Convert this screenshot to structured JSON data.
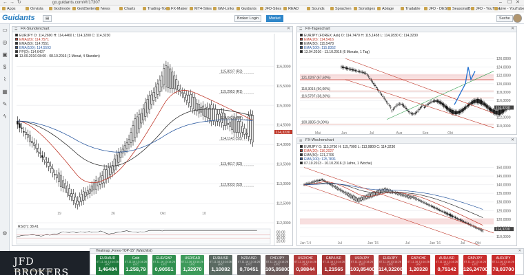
{
  "browser": {
    "url": "go.guidants.com/#!/17307",
    "window_controls": [
      "–",
      "☐",
      "✕"
    ]
  },
  "bookmarks": [
    "Apps",
    "Onvista",
    "Godmode",
    "GoldSeiten",
    "News",
    "Charts",
    "Trading-Tools",
    "FX-Maker",
    "MT4-Sites",
    "GM-Links",
    "Guidants",
    "JFD-Sites",
    "READ",
    "Sounds",
    "Sprachen",
    "Sonstiges",
    "Ablage",
    "Tradable",
    "JFD - DESK",
    "SeasonalBull",
    "JFD - YouTube",
    "Live - YouTube"
  ],
  "header": {
    "logo": "Guidants",
    "broker_login": "Broker Login",
    "market": "Market",
    "search": "Suche"
  },
  "left_toolbar_icons": [
    "monitor-icon",
    "globe-icon",
    "briefcase-icon",
    "dollar-icon",
    "chart-icon",
    "gift-icon",
    "pen-icon",
    "bolt-icon",
    "gear-icon"
  ],
  "panels": {
    "stunden": {
      "title": "FX-Stundenchart",
      "legend": [
        {
          "text": "EURJPY   O: 114,2690  H: 114,4460  L: 114,1200  C: 114,3230",
          "color": "#222222"
        },
        {
          "text": "EMA(20): 114,7571",
          "color": "#c0392b"
        },
        {
          "text": "EMA(50): 114,7551",
          "color": "#333333"
        },
        {
          "text": "EMA(100): 114,5593",
          "color": "#2c5aa0"
        },
        {
          "text": "PP(D): 114,6427",
          "color": "#333333"
        },
        {
          "text": "13.09.2016 08:00 - 08.10.2016 (1 Monat, 4 Stunden)",
          "color": "#222222"
        }
      ],
      "levels": [
        {
          "label": "115,8237 (R2)"
        },
        {
          "label": "115,2953 (R1)"
        },
        {
          "label": "114,6427 (PP)"
        },
        {
          "label": "114,1143 (S1)"
        },
        {
          "label": "113,4617 (S2)"
        },
        {
          "label": "112,9333 (S3)"
        }
      ],
      "y_ticks": [
        "116,0000",
        "115,5000",
        "115,0000",
        "114,5000",
        "114,0000",
        "113,5000",
        "113,0000",
        "112,5000",
        "112,0000"
      ],
      "x_ticks": [
        "19",
        "26",
        "Okt",
        "10"
      ],
      "last_price": "114,3230",
      "rsi_label": "RSI(7): 38,41",
      "rsi_ticks": [
        "80,00",
        "60,00",
        "40,00",
        "20,00"
      ]
    },
    "tages": {
      "title": "FX-Tageschart",
      "legend": [
        {
          "text": "EURJPY (FOREX: Ask)  O: 114,7470  H: 115,1458  L: 114,2830  C: 114,3230",
          "color": "#222222"
        },
        {
          "text": "EMA(20): 114,5416",
          "color": "#c0392b"
        },
        {
          "text": "EMA(50): 115,5478",
          "color": "#333333"
        },
        {
          "text": "EMA(100): 115,8352",
          "color": "#2c5aa0"
        },
        {
          "text": "13.04.2016 - 13.10.2016 (6 Monate, 1 Tag)",
          "color": "#222222"
        }
      ],
      "fib_labels": [
        "121,0247 (67,60%)",
        "118,3015 (50,00%)",
        "116,5797 (38,20%)",
        "100,3835 (0,00%)"
      ],
      "y_ticks": [
        "126,0000",
        "124,0000",
        "122,0000",
        "120,0000",
        "118,0000",
        "116,0000",
        "114,0000",
        "112,0000",
        "110,0000"
      ],
      "x_ticks": [
        "Mai",
        "Jun",
        "Jul",
        "Aug",
        "Sep",
        "Okt"
      ],
      "last_price": "114,3230"
    },
    "wochen": {
      "title": "FX-Wochenchart",
      "legend": [
        {
          "text": "EURJPY  O: 115,3750  H: 115,7900  L: 113,9800  C: 114,3230",
          "color": "#222222"
        },
        {
          "text": "EMA(20): 116,2027",
          "color": "#c0392b"
        },
        {
          "text": "EMA(50): 121,2706",
          "color": "#333333"
        },
        {
          "text": "EMA(100): 125,7831",
          "color": "#2c5aa0"
        },
        {
          "text": "07.10.2013 - 10.10.2016 (3 Jahre, 1 Woche)",
          "color": "#222222"
        }
      ],
      "y_ticks": [
        "150,0000",
        "145,0000",
        "140,0000",
        "135,0000",
        "130,0000",
        "125,0000",
        "120,0000",
        "115,0000",
        "110,0000"
      ],
      "x_ticks": [
        "Jan '14",
        "Jul",
        "Jan '15",
        "Jul",
        "Jan '16",
        "Jul",
        "Okt"
      ],
      "last_price": "114,3230"
    }
  },
  "heatmap": {
    "title": "Heatmap „Forex-TOP-15\" (Watchlist)",
    "tiles": [
      {
        "pair": "EUR/AUD",
        "sub": "07.11.16 13:14:26 UTC",
        "value": "1,46484",
        "color": "#1f7a3d"
      },
      {
        "pair": "Gold",
        "sub": "07.11.16 13:14:26 UTC",
        "value": "1.258,79",
        "color": "#2f8f4e"
      },
      {
        "pair": "EUR/GBP",
        "sub": "07.11.16 13:14:26 UTC",
        "value": "0,90551",
        "color": "#2f8f4e"
      },
      {
        "pair": "USD/CAD",
        "sub": "07.11.16 13:14:26 UTC",
        "value": "1,32970",
        "color": "#3d9a5a"
      },
      {
        "pair": "EUR/USD",
        "sub": "07.11.16 13:14:26 UTC",
        "value": "1,10082",
        "color": "#5a6a62"
      },
      {
        "pair": "NZD/USD",
        "sub": "07.11.16 13:14:26 UTC",
        "value": "0,70451",
        "color": "#606060"
      },
      {
        "pair": "CHF/JPY",
        "sub": "07.11.16 13:14:26 UTC",
        "value": "105,05800",
        "color": "#6a5a5a"
      },
      {
        "pair": "USD/CHF",
        "sub": "07.11.16 13:14:26 UTC",
        "value": "0,98844",
        "color": "#b23a3a"
      },
      {
        "pair": "GBP/USD",
        "sub": "07.11.16 13:14:26 UTC",
        "value": "1,21565",
        "color": "#a83434"
      },
      {
        "pair": "USD/JPY",
        "sub": "07.11.16 13:14:26 UTC",
        "value": "103,85400",
        "color": "#b23a3a"
      },
      {
        "pair": "EUR/JPY",
        "sub": "07.11.16 13:14:26 UTC",
        "value": "114,32200",
        "color": "#b23a3a"
      },
      {
        "pair": "GBP/CHF",
        "sub": "07.11.16 13:14:26 UTC",
        "value": "1,20328",
        "color": "#bf3030"
      },
      {
        "pair": "AUD/USD",
        "sub": "07.11.16 13:14:26 UTC",
        "value": "0,75142",
        "color": "#c72b2b"
      },
      {
        "pair": "GBP/JPY",
        "sub": "07.11.16 13:14:26 UTC",
        "value": "126,24700",
        "color": "#c72b2b"
      },
      {
        "pair": "AUD/JPY",
        "sub": "07.11.16 13:14:26 UTC",
        "value": "78,03700",
        "color": "#c72b2b"
      }
    ]
  },
  "broker_banner": {
    "name": "JFD BROKERS",
    "subline": "LIVE THE TRADING LIFE"
  }
}
